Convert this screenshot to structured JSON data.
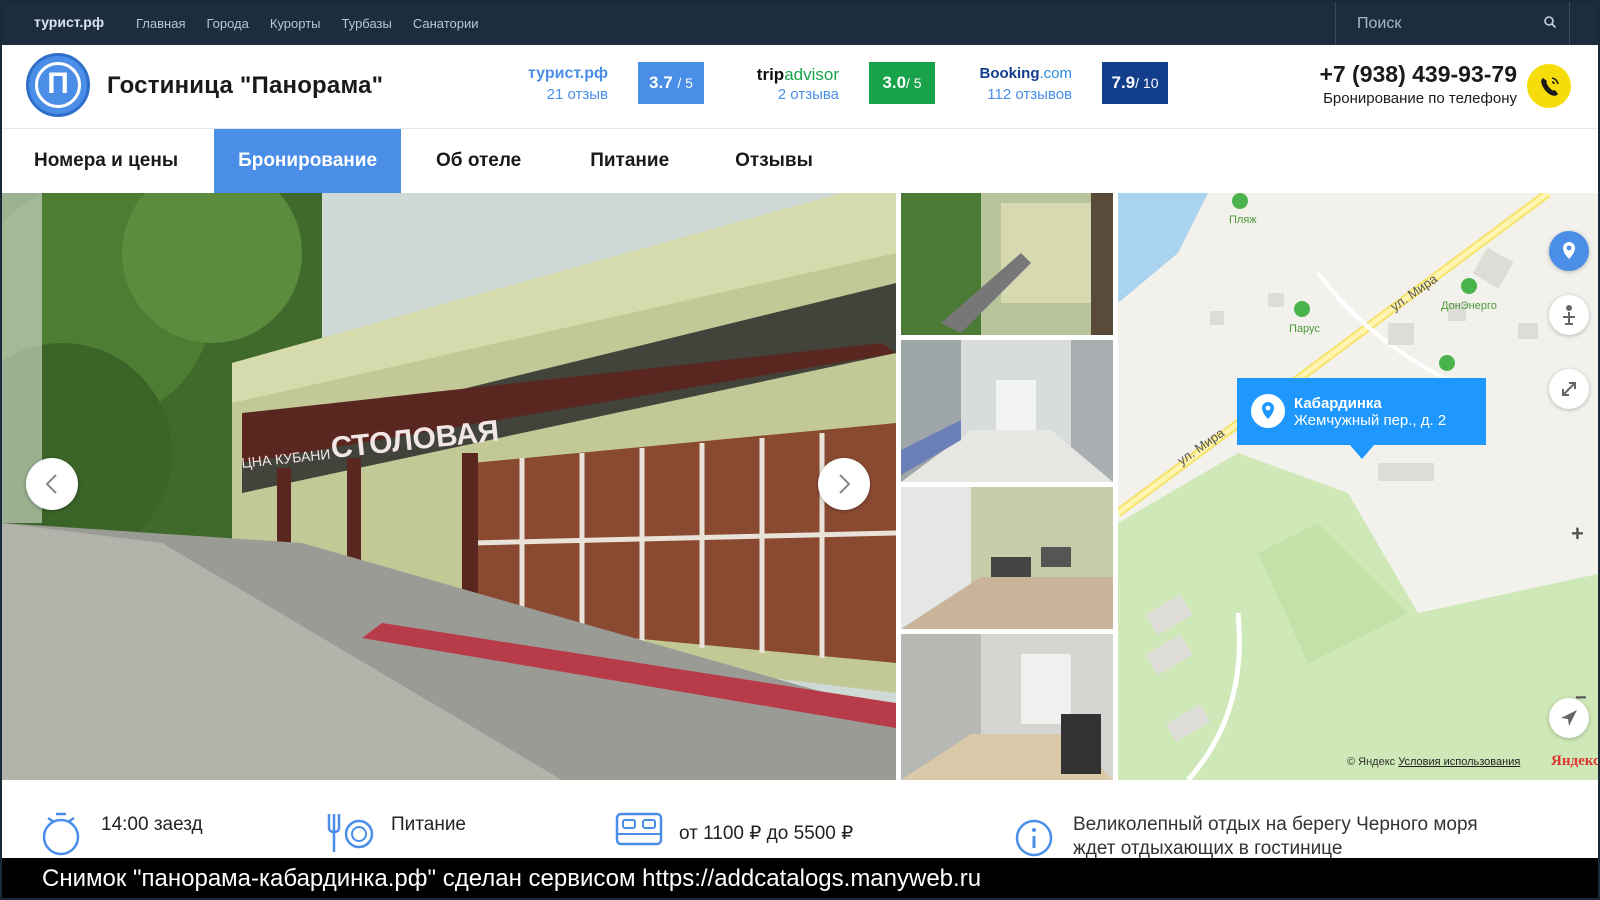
{
  "topbar": {
    "logo": "турист.рф",
    "nav": [
      "Главная",
      "Города",
      "Курорты",
      "Турбазы",
      "Санатории"
    ],
    "search_placeholder": "Поиск"
  },
  "header": {
    "logo_letter": "П",
    "title": "Гостиница \"Панорама\"",
    "ratings": [
      {
        "name": "турист.рф",
        "count": "21 отзыв",
        "score": "3.7",
        "max": "/ 5",
        "color": "#4a8ee8"
      },
      {
        "name_left": "trip",
        "name_right": "advisor",
        "count": "2 отзыва",
        "score": "3.0",
        "max": "/ 5",
        "color": "#18a24a"
      },
      {
        "name_left": "Booking",
        "name_right": ".com",
        "count": "112 отзывов",
        "score": "7.9",
        "max": "/ 10",
        "color": "#123e8c"
      }
    ],
    "phone": "+7 (938) 439-93-79",
    "phone_note": "Бронирование по телефону"
  },
  "tabs": [
    {
      "label": "Номера и цены",
      "active": false
    },
    {
      "label": "Бронирование",
      "active": true
    },
    {
      "label": "Об отеле",
      "active": false
    },
    {
      "label": "Питание",
      "active": false
    },
    {
      "label": "Отзывы",
      "active": false
    }
  ],
  "gallery": {
    "hero_sign_1": "СТОЛОВАЯ",
    "hero_sign_2": "ЦНА КУБАНИ"
  },
  "map": {
    "place": "Кабардинка",
    "address": "Жемчужный пер., д. 2",
    "labels": [
      "Пляж",
      "Парус",
      "ДонЭнерго"
    ],
    "streets": [
      "ул. Мира",
      "ул. Мира"
    ],
    "copyright": "© Яндекс",
    "terms": "Условия использования",
    "brand": "Яндекс",
    "zoom_in": "+",
    "zoom_out": "−"
  },
  "info": {
    "checkin": "14:00 заезд",
    "food": "Питание",
    "price": "от 1100 ₽ до 5500 ₽",
    "description": "Великолепный отдых на берегу Черного моря ждет отдыхающих в гостинице"
  },
  "caption": "Снимок \"панорама-кабардинка.рф\" сделан сервисом https://addcatalogs.manyweb.ru"
}
